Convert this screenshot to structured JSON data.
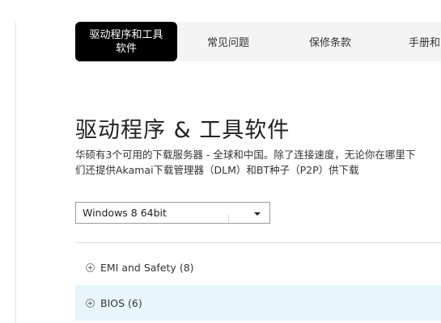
{
  "tabs": [
    {
      "label_line1": "驱动程序和工具",
      "label_line2": "软件",
      "active": true
    },
    {
      "label": "常见问题"
    },
    {
      "label": "保修条款"
    },
    {
      "label": "手册和"
    }
  ],
  "page_title": "驱动程序 & 工具软件",
  "description": {
    "line1": "华硕有3个可用的下载服务器 - 全球和中国。除了连接速度，无论你在哪里下",
    "line2": "们还提供Akamai下载管理器（DLM）和BT种子（P2P）供下载"
  },
  "os_select": {
    "value": "Windows 8 64bit"
  },
  "categories": [
    {
      "name": "EMI and Safety",
      "count": "(8)"
    },
    {
      "name": "BIOS",
      "count": "(6)"
    }
  ],
  "icons": {
    "expand": "plus-circle-icon",
    "dropdown": "caret-down-icon"
  }
}
